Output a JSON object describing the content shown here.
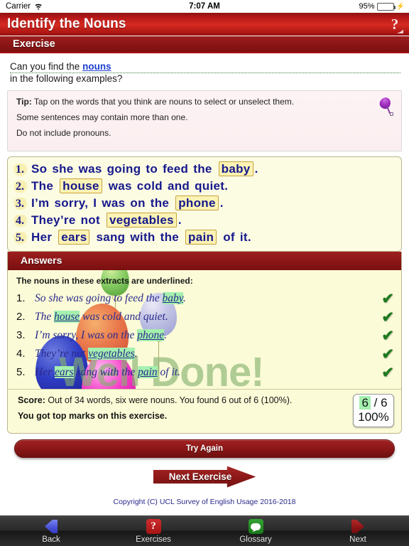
{
  "statusbar": {
    "carrier": "Carrier",
    "time": "7:07 AM",
    "battery": "95%"
  },
  "header": {
    "title": "Identify the Nouns",
    "help_icon": "question-mark-icon",
    "subtitle": "Exercise"
  },
  "question": {
    "prefix": "Can you find the ",
    "keyword": "nouns",
    "suffix": " in the following examples?"
  },
  "tip": {
    "label": "Tip:",
    "line1": " Tap on the words that you think are nouns to select or unselect them.",
    "line2": "Some sentences may contain more than one.",
    "line3": "Do not include pronouns.",
    "icon": "purple-balloon-icon"
  },
  "exercise": {
    "sentences": [
      {
        "num": "1.",
        "parts": [
          {
            "t": "So she was going to feed the ",
            "sel": false
          },
          {
            "t": "baby",
            "sel": true
          },
          {
            "t": ".",
            "sel": false
          }
        ]
      },
      {
        "num": "2.",
        "parts": [
          {
            "t": "The ",
            "sel": false
          },
          {
            "t": "house",
            "sel": true
          },
          {
            "t": " was cold and quiet.",
            "sel": false
          }
        ]
      },
      {
        "num": "3.",
        "parts": [
          {
            "t": "I’m sorry, I was on the ",
            "sel": false
          },
          {
            "t": "phone",
            "sel": true
          },
          {
            "t": ".",
            "sel": false
          }
        ]
      },
      {
        "num": "4.",
        "parts": [
          {
            "t": "They’re not ",
            "sel": false
          },
          {
            "t": "vegetables",
            "sel": true
          },
          {
            "t": ".",
            "sel": false
          }
        ]
      },
      {
        "num": "5.",
        "parts": [
          {
            "t": "Her ",
            "sel": false
          },
          {
            "t": "ears",
            "sel": true
          },
          {
            "t": " sang with the ",
            "sel": false
          },
          {
            "t": "pain",
            "sel": true
          },
          {
            "t": " of it.",
            "sel": false
          }
        ]
      }
    ]
  },
  "answers": {
    "heading": "Answers",
    "lead": "The nouns in these extracts are underlined:",
    "tick_glyph": "✔",
    "rows": [
      {
        "num": "1.",
        "parts": [
          {
            "t": "So she was going to feed the ",
            "hl": false
          },
          {
            "t": "baby",
            "hl": true
          },
          {
            "t": ".",
            "hl": false
          }
        ],
        "correct": true
      },
      {
        "num": "2.",
        "parts": [
          {
            "t": "The ",
            "hl": false
          },
          {
            "t": "house",
            "hl": true
          },
          {
            "t": " was cold and quiet.",
            "hl": false
          }
        ],
        "correct": true
      },
      {
        "num": "3.",
        "parts": [
          {
            "t": "I’m sorry, I was on the ",
            "hl": false
          },
          {
            "t": "phone",
            "hl": true
          },
          {
            "t": ".",
            "hl": false
          }
        ],
        "correct": true
      },
      {
        "num": "4.",
        "parts": [
          {
            "t": "They’re not ",
            "hl": false
          },
          {
            "t": "vegetables",
            "hl": true
          },
          {
            "t": ".",
            "hl": false
          }
        ],
        "correct": true
      },
      {
        "num": "5.",
        "parts": [
          {
            "t": "Her ",
            "hl": false
          },
          {
            "t": "ears",
            "hl": true
          },
          {
            "t": " sang with the ",
            "hl": false
          },
          {
            "t": "pain",
            "hl": true
          },
          {
            "t": " of it.",
            "hl": false
          }
        ],
        "correct": true
      }
    ],
    "watermark": "Well Done!"
  },
  "score": {
    "label": "Score:",
    "line1": " Out of 34 words, six were nouns. You found 6 out of 6 (100%).",
    "line2": "You got top marks on this exercise.",
    "badge_got": "6",
    "badge_sep": " / ",
    "badge_total": "6",
    "badge_percent": "100%"
  },
  "buttons": {
    "try_again": "Try Again",
    "next_exercise": "Next Exercise"
  },
  "footer": {
    "copyright": "Copyright (C) UCL Survey of English Usage 2016-2018"
  },
  "tabbar": {
    "items": [
      {
        "label": "Back",
        "icon": "back-chevron-icon"
      },
      {
        "label": "Exercises",
        "icon": "question-mark-square-icon",
        "glyph": "?"
      },
      {
        "label": "Glossary",
        "icon": "speech-bubble-icon"
      },
      {
        "label": "Next",
        "icon": "next-chevron-icon"
      }
    ]
  },
  "colors": {
    "brand_red": "#8d1818",
    "answer_yellow": "#fbfbd7",
    "highlight_green": "#a4f0ae",
    "select_yellow": "#fbf3b4"
  }
}
